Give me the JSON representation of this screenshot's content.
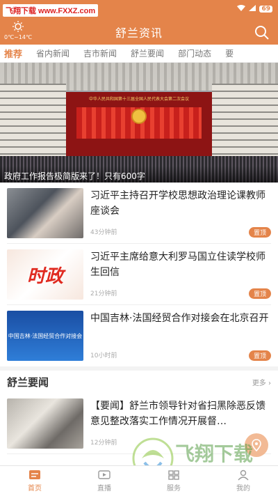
{
  "watermark_top": "飞翔下载 www.FXXZ.com",
  "status": {
    "battery": "69"
  },
  "weather": {
    "temp": "0℃~14℃"
  },
  "header": {
    "title": "舒兰资讯"
  },
  "tabs": [
    "推荐",
    "省内新闻",
    "吉市新闻",
    "舒兰要闻",
    "部门动态",
    "要"
  ],
  "hero": {
    "banner_text": "中华人民共和国第十三届全国人民代表大会第二次会议",
    "caption": "政府工作报告极简版来了！只有600字"
  },
  "news": [
    {
      "title": "习近平主持召开学校思想政治理论课教师座谈会",
      "time": "43分钟前",
      "badge": "置顶"
    },
    {
      "title": "习近平主席给意大利罗马国立住读学校师生回信",
      "time": "21分钟前",
      "badge": "置顶",
      "thumb_text": "时政"
    },
    {
      "title": "中国吉林·法国经贸合作对接会在北京召开",
      "time": "10小时前",
      "badge": "置顶",
      "thumb_text": "中国吉林·法国经贸合作对接会"
    }
  ],
  "section": {
    "title": "舒兰要闻",
    "more": "更多"
  },
  "news2": [
    {
      "title": "【要闻】舒兰市领导针对省扫黑除恶反馈意见整改落实工作情况开展督…",
      "time": "12分钟前"
    }
  ],
  "bottom_nav": [
    "首页",
    "直播",
    "服务",
    "我的"
  ],
  "watermark_bottom": {
    "brand": "飞翔下载",
    "url": "www.fxxz.com"
  },
  "colors": {
    "accent": "#e4844a"
  }
}
